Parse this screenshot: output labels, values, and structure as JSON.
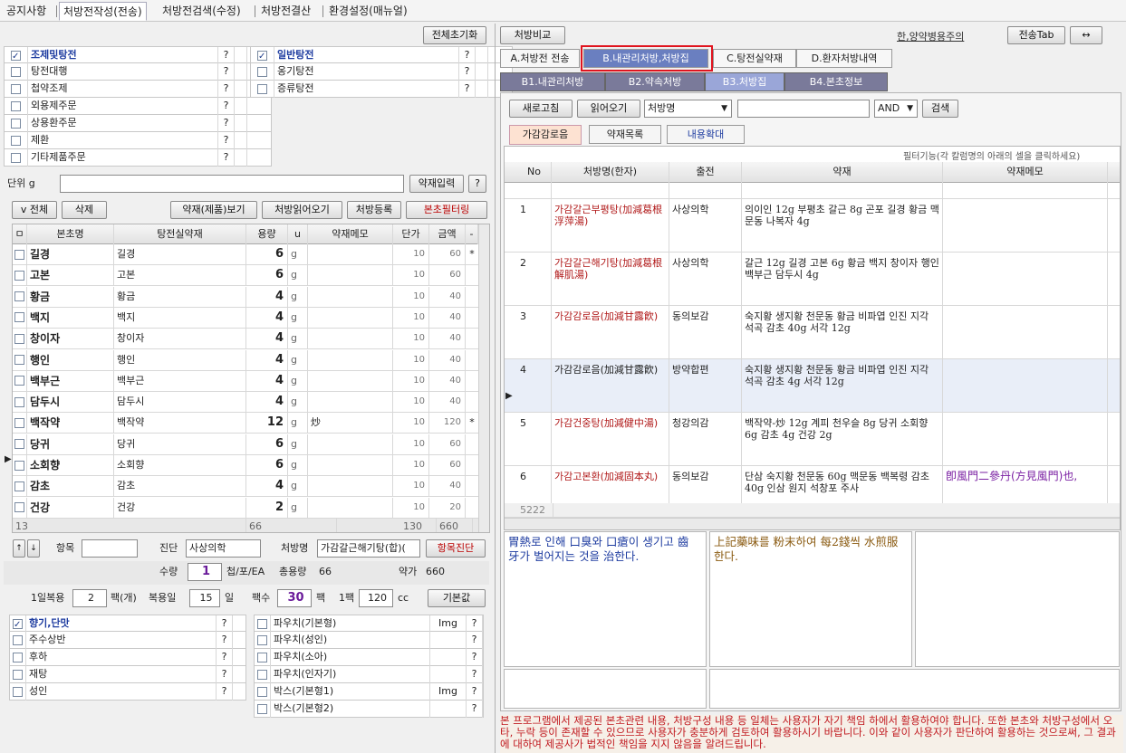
{
  "top_tabs": [
    "공지사항",
    "처방전작성(전송)",
    "처방전검색(수정)",
    "처방전결산",
    "환경설정(매뉴얼)"
  ],
  "left": {
    "reset_all": "전체초기화",
    "categories_left": [
      {
        "label": "조제및탕전",
        "checked": true,
        "q": "?"
      },
      {
        "label": "탕전대행",
        "checked": false,
        "q": "?"
      },
      {
        "label": "첩약조제",
        "checked": false,
        "q": "?"
      },
      {
        "label": "외용제주문",
        "checked": false,
        "q": "?"
      },
      {
        "label": "상용환주문",
        "checked": false,
        "q": "?"
      },
      {
        "label": "제환",
        "checked": false,
        "q": "?"
      },
      {
        "label": "기타제품주문",
        "checked": false,
        "q": "?"
      }
    ],
    "categories_right": [
      {
        "label": "일반탕전",
        "checked": true,
        "q": "?"
      },
      {
        "label": "옹기탕전",
        "checked": false,
        "q": "?"
      },
      {
        "label": "증류탕전",
        "checked": false,
        "q": "?"
      }
    ],
    "unit_label": "단위 g",
    "herb_input_btn": "약재입력",
    "q_btn": "?",
    "toolbar": {
      "all": "v 전체",
      "delete": "삭제",
      "view_herb": "약재(제품)보기",
      "read_rx": "처방읽어오기",
      "register_rx": "처방등록",
      "filter": "본초필터링"
    },
    "herb_table": {
      "headers": [
        "ㅁ",
        "본초명",
        "탕전실약재",
        "용량",
        "u",
        "약재메모",
        "단가",
        "금액",
        "-"
      ],
      "rows": [
        {
          "name": "길경",
          "room": "길경",
          "qty": "6",
          "u": "g",
          "memo": "",
          "price": "10",
          "amount": "60",
          "mark": "*"
        },
        {
          "name": "고본",
          "room": "고본",
          "qty": "6",
          "u": "g",
          "memo": "",
          "price": "10",
          "amount": "60",
          "mark": ""
        },
        {
          "name": "황금",
          "room": "황금",
          "qty": "4",
          "u": "g",
          "memo": "",
          "price": "10",
          "amount": "40",
          "mark": ""
        },
        {
          "name": "백지",
          "room": "백지",
          "qty": "4",
          "u": "g",
          "memo": "",
          "price": "10",
          "amount": "40",
          "mark": ""
        },
        {
          "name": "창이자",
          "room": "창이자",
          "qty": "4",
          "u": "g",
          "memo": "",
          "price": "10",
          "amount": "40",
          "mark": ""
        },
        {
          "name": "행인",
          "room": "행인",
          "qty": "4",
          "u": "g",
          "memo": "",
          "price": "10",
          "amount": "40",
          "mark": ""
        },
        {
          "name": "백부근",
          "room": "백부근",
          "qty": "4",
          "u": "g",
          "memo": "",
          "price": "10",
          "amount": "40",
          "mark": ""
        },
        {
          "name": "담두시",
          "room": "담두시",
          "qty": "4",
          "u": "g",
          "memo": "",
          "price": "10",
          "amount": "40",
          "mark": ""
        },
        {
          "name": "백작약",
          "room": "백작약",
          "qty": "12",
          "u": "g",
          "memo": "炒",
          "price": "10",
          "amount": "120",
          "mark": "*"
        },
        {
          "name": "당귀",
          "room": "당귀",
          "qty": "6",
          "u": "g",
          "memo": "",
          "price": "10",
          "amount": "60",
          "mark": ""
        },
        {
          "name": "소회향",
          "room": "소회향",
          "qty": "6",
          "u": "g",
          "memo": "",
          "price": "10",
          "amount": "60",
          "mark": ""
        },
        {
          "name": "감초",
          "room": "감초",
          "qty": "4",
          "u": "g",
          "memo": "",
          "price": "10",
          "amount": "40",
          "mark": ""
        },
        {
          "name": "건강",
          "room": "건강",
          "qty": "2",
          "u": "g",
          "memo": "",
          "price": "10",
          "amount": "20",
          "mark": ""
        }
      ],
      "footer": {
        "count": "13",
        "qty_total": "66",
        "price_total": "130",
        "amount_total": "660"
      }
    },
    "diag_row": {
      "item_label": "항목",
      "diag_label": "진단",
      "diag_value": "사상의학",
      "rxname_label": "처방명",
      "rxname_value": "가감갈근해기탕(합)(",
      "item_diag_btn": "항목진단"
    },
    "qty_row": {
      "qty_label": "수량",
      "qty_value": "1",
      "unit": "첩/포/EA",
      "total_label": "총용량",
      "total_value": "66",
      "price_label": "약가",
      "price_value": "660"
    },
    "dose_row": {
      "daily_label": "1일복용",
      "daily_value": "2",
      "daily_unit": "팩(개)",
      "days_label": "복용일",
      "days_value": "15",
      "days_unit": "일",
      "packs_label": "팩수",
      "packs_value": "30",
      "packs_unit": "팩",
      "per_pack_label": "1팩",
      "per_pack_value": "120",
      "per_pack_unit": "cc",
      "default_btn": "기본값"
    },
    "options_left": [
      {
        "label": "향기,단맛",
        "checked": true,
        "q": "?"
      },
      {
        "label": "주수상반",
        "checked": false,
        "q": "?"
      },
      {
        "label": "후하",
        "checked": false,
        "q": "?"
      },
      {
        "label": "재탕",
        "checked": false,
        "q": "?"
      },
      {
        "label": "성인",
        "checked": false,
        "q": "?"
      }
    ],
    "options_right": [
      {
        "label": "파우치(기본형)",
        "img": "Img",
        "q": "?"
      },
      {
        "label": "파우치(성인)",
        "img": "",
        "q": "?"
      },
      {
        "label": "파우치(소아)",
        "img": "",
        "q": "?"
      },
      {
        "label": "파우치(인자기)",
        "img": "",
        "q": "?"
      },
      {
        "label": "박스(기본형1)",
        "img": "Img",
        "q": "?"
      },
      {
        "label": "박스(기본형2)",
        "img": "",
        "q": "?"
      }
    ]
  },
  "right": {
    "compare_btn": "처방비교",
    "warning_link": "한,양약병용주의",
    "send_tab_btn": "전송Tab",
    "swap_btn": "↔",
    "main_tabs": [
      "A.처방전 전송",
      "B.내관리처방,처방집",
      "C.탕전실약재",
      "D.환자처방내역"
    ],
    "sub_tabs": [
      "B1.내관리처방",
      "B2.약속처방",
      "B3.처방집",
      "B4.본초정보"
    ],
    "search": {
      "refresh": "새로고침",
      "read": "읽어오기",
      "field": "처방명",
      "query": "",
      "op": "AND",
      "search_btn": "검색"
    },
    "inner_tabs": [
      "가감감로음",
      "약재목록",
      "내용확대"
    ],
    "filter_note": "필터기능(각 칼럼명의 아래의 셀을 클릭하세요)",
    "rx_table": {
      "headers": [
        "No",
        "처방명(한자)",
        "출전",
        "약재",
        "약재메모"
      ],
      "rows": [
        {
          "no": "1",
          "name": "가감갈근부평탕(加減葛根浮萍湯)",
          "source": "사상의학",
          "herbs": "의이인 12g 부평초 갈근 8g 곤포 길경 황금 맥문동 나복자 4g",
          "memo": ""
        },
        {
          "no": "2",
          "name": "가감갈근해기탕(加減葛根解肌湯)",
          "source": "사상의학",
          "herbs": "갈근 12g 길경 고본 6g 황금 백지 창이자 행인 백부근 담두시 4g",
          "memo": ""
        },
        {
          "no": "3",
          "name": "가감감로음(加減甘露飮)",
          "source": "동의보감",
          "herbs": "숙지황 생지황 천문동 황금 비파엽 인진 지각 석곡 감초 40g 서각 12g",
          "memo": ""
        },
        {
          "no": "4",
          "name": "가감감로음(加減甘露飮)",
          "source": "방약합편",
          "herbs": "숙지황 생지황 천문동 황금 비파엽 인진 지각 석곡 감초 4g 서각 12g",
          "memo": ""
        },
        {
          "no": "5",
          "name": "가감건중탕(加減健中湯)",
          "source": "청강의감",
          "herbs": "백작약-炒 12g 계피 천우슬 8g 당귀 소회향 6g 감초 4g 건강 2g",
          "memo": ""
        },
        {
          "no": "6",
          "name": "가감고본환(加減固本丸)",
          "source": "동의보감",
          "herbs": "단삼 숙지황 천문동 60g 맥문동 백복령 감초 40g 인삼 원지 석창포 주사",
          "memo": "卽風門二參丹(方見風門)也,"
        }
      ],
      "footer_count": "5222"
    },
    "text_panel1": "胃熱로 인해 口臭와 口瘡이 생기고 齒牙가 벌어지는 것을 治한다.",
    "text_panel2": "上記藥味를 粉末하여 每2錢씩 水煎服한다.",
    "text_panel3": "",
    "disclaimer": "본 프로그램에서 제공된 본초관련 내용, 처방구성 내용 등 일체는 사용자가 자기 책임 하에서 활용하여야 합니다. 또한 본초와 처방구성에서 오타, 누락 등이 존재할 수 있으므로 사용자가 충분하게 검토하여 활용하시기 바랍니다. 이와 같이 사용자가 판단하여 활용하는 것으로써, 그 결과에 대하여 제공사가 법적인 책임을 지지 않음을 알려드립니다."
  }
}
